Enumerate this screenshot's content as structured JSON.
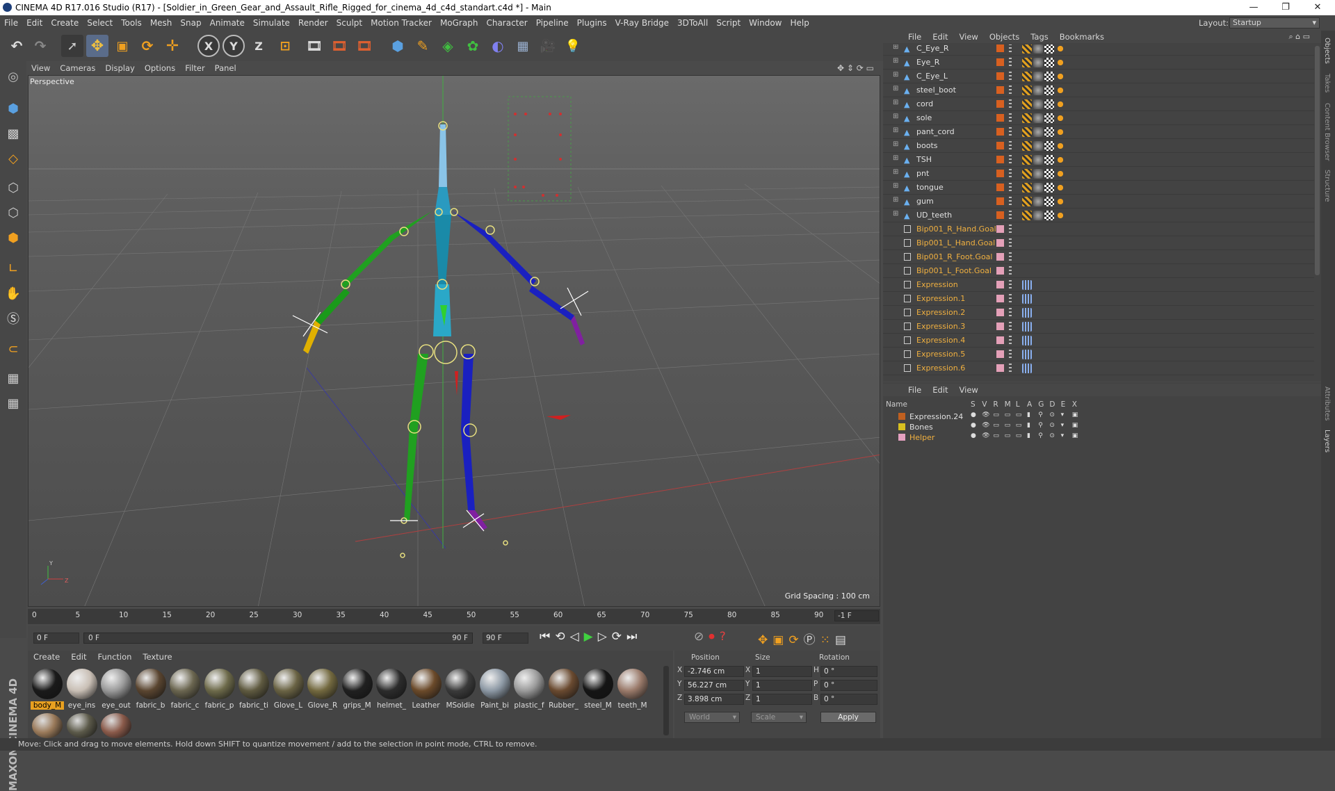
{
  "window": {
    "title": "CINEMA 4D R17.016 Studio (R17) - [Soldier_in_Green_Gear_and_Assault_Rifle_Rigged_for_cinema_4d_c4d_standart.c4d *] - Main",
    "minimize": "—",
    "restore": "❐",
    "close": "✕"
  },
  "menu": [
    "File",
    "Edit",
    "Create",
    "Select",
    "Tools",
    "Mesh",
    "Snap",
    "Animate",
    "Simulate",
    "Render",
    "Sculpt",
    "Motion Tracker",
    "MoGraph",
    "Character",
    "Pipeline",
    "Plugins",
    "V-Ray Bridge",
    "3DToAll",
    "Script",
    "Window",
    "Help"
  ],
  "layout": {
    "label": "Layout:",
    "value": "Startup"
  },
  "toolbar": {
    "x_axis": "X",
    "y_axis": "Y",
    "z_axis": "Z"
  },
  "viewport": {
    "menu": [
      "View",
      "Cameras",
      "Display",
      "Options",
      "Filter",
      "Panel"
    ],
    "label": "Perspective",
    "grid_spacing": "Grid Spacing : 100 cm",
    "axis_y": "Y",
    "axis_z": "Z"
  },
  "timeline": {
    "ticks": [
      "0",
      "5",
      "10",
      "15",
      "20",
      "25",
      "30",
      "35",
      "40",
      "45",
      "50",
      "55",
      "60",
      "65",
      "70",
      "75",
      "80",
      "85",
      "90"
    ],
    "end_field": "-1 F",
    "current_frame": "0 F",
    "range_start": "0 F",
    "range_end": "90 F",
    "max_frame": "90 F"
  },
  "materials": {
    "menu": [
      "Create",
      "Edit",
      "Function",
      "Texture"
    ],
    "items": [
      {
        "label": "body_M",
        "color": "#1a1a1a"
      },
      {
        "label": "eye_ins",
        "color": "#c9bfb5"
      },
      {
        "label": "eye_out",
        "color": "#9a9a9a"
      },
      {
        "label": "fabric_b",
        "color": "#5a4530"
      },
      {
        "label": "fabric_c",
        "color": "#6b6650"
      },
      {
        "label": "fabric_p",
        "color": "#6d6a4a"
      },
      {
        "label": "fabric_ti",
        "color": "#5f5a40"
      },
      {
        "label": "Glove_L",
        "color": "#6a6344"
      },
      {
        "label": "Glove_R",
        "color": "#73693f"
      },
      {
        "label": "grips_M",
        "color": "#202020"
      },
      {
        "label": "helmet_",
        "color": "#2c2c2c"
      },
      {
        "label": "Leather",
        "color": "#6b4a2a"
      },
      {
        "label": "MSoldie",
        "color": "#3a3a3a"
      },
      {
        "label": "Paint_bi",
        "color": "#8c98a4"
      },
      {
        "label": "plastic_f",
        "color": "#9a9a9a"
      },
      {
        "label": "Rubber_",
        "color": "#6a4a30"
      },
      {
        "label": "steel_M",
        "color": "#151515"
      },
      {
        "label": "teeth_M",
        "color": "#9a7a6a"
      }
    ],
    "row2": [
      {
        "color": "#9a7a5a"
      },
      {
        "color": "#5c5a4a"
      },
      {
        "color": "#8a5a4a"
      }
    ]
  },
  "coords": {
    "headers": [
      "Position",
      "Size",
      "Rotation"
    ],
    "rows": [
      {
        "axis": "X",
        "pos": "-2.746 cm",
        "saxis": "X",
        "size": "1",
        "raxis": "H",
        "rot": "0 °"
      },
      {
        "axis": "Y",
        "pos": "56.227 cm",
        "saxis": "Y",
        "size": "1",
        "raxis": "P",
        "rot": "0 °"
      },
      {
        "axis": "Z",
        "pos": "3.898 cm",
        "saxis": "Z",
        "size": "1",
        "raxis": "B",
        "rot": "0 °"
      }
    ],
    "space": "World",
    "mode": "Scale",
    "apply": "Apply"
  },
  "objects": {
    "menu": [
      "File",
      "Edit",
      "View",
      "Objects",
      "Tags",
      "Bookmarks"
    ],
    "rows": [
      {
        "name": "C_Eye_R",
        "kind": "mesh"
      },
      {
        "name": "Eye_R",
        "kind": "mesh"
      },
      {
        "name": "C_Eye_L",
        "kind": "mesh"
      },
      {
        "name": "steel_boot",
        "kind": "mesh"
      },
      {
        "name": "cord",
        "kind": "mesh"
      },
      {
        "name": "sole",
        "kind": "mesh"
      },
      {
        "name": "pant_cord",
        "kind": "mesh"
      },
      {
        "name": "boots",
        "kind": "mesh"
      },
      {
        "name": "TSH",
        "kind": "mesh"
      },
      {
        "name": "pnt",
        "kind": "mesh"
      },
      {
        "name": "tongue",
        "kind": "mesh"
      },
      {
        "name": "gum",
        "kind": "mesh"
      },
      {
        "name": "UD_teeth",
        "kind": "mesh"
      },
      {
        "name": "Bip001_R_Hand.Goal",
        "kind": "goal"
      },
      {
        "name": "Bip001_L_Hand.Goal",
        "kind": "goal"
      },
      {
        "name": "Bip001_R_Foot.Goal",
        "kind": "goal"
      },
      {
        "name": "Bip001_L_Foot.Goal",
        "kind": "goal"
      },
      {
        "name": "Expression",
        "kind": "expr"
      },
      {
        "name": "Expression.1",
        "kind": "expr"
      },
      {
        "name": "Expression.2",
        "kind": "expr"
      },
      {
        "name": "Expression.3",
        "kind": "expr"
      },
      {
        "name": "Expression.4",
        "kind": "expr"
      },
      {
        "name": "Expression.5",
        "kind": "expr"
      },
      {
        "name": "Expression.6",
        "kind": "expr"
      }
    ]
  },
  "layers": {
    "menu": [
      "File",
      "Edit",
      "View"
    ],
    "columns": [
      "Name",
      "S",
      "V",
      "R",
      "M",
      "L",
      "A",
      "G",
      "D",
      "E",
      "X"
    ],
    "rows": [
      {
        "name": "Expression.24",
        "color": "#c06020"
      },
      {
        "name": "Bones",
        "color": "#d8c020"
      },
      {
        "name": "Helper",
        "color": "#e4a0c0"
      }
    ]
  },
  "side_tabs": [
    "Objects",
    "Takes",
    "Content Browser",
    "Structure",
    "Attributes",
    "Layers"
  ],
  "status": "Move: Click and drag to move elements. Hold down SHIFT to quantize movement / add to the selection in point mode, CTRL to remove.",
  "brand": "MAXON CINEMA 4D"
}
